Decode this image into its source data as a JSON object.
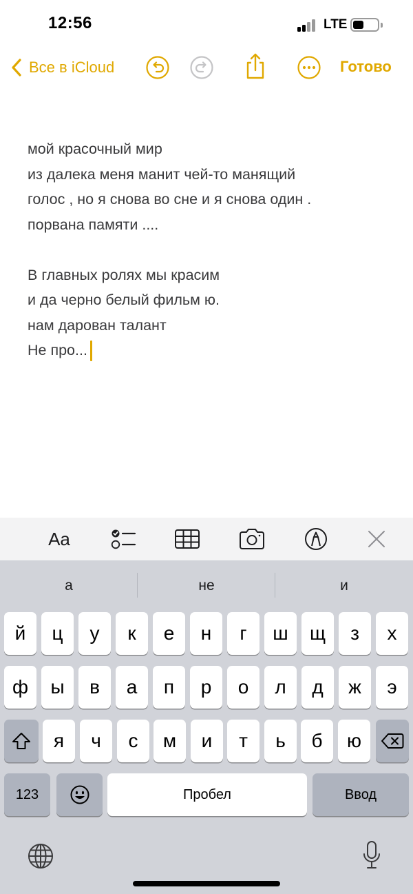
{
  "status_bar": {
    "time": "12:56",
    "network": "LTE"
  },
  "nav": {
    "back_label": "Все в iCloud",
    "done_label": "Готово",
    "icons": [
      "chevron-left-icon",
      "undo-icon",
      "redo-icon",
      "share-icon",
      "more-icon"
    ]
  },
  "note": {
    "lines": [
      "мой красочный мир",
      "из далека меня манит чей-то манящий",
      "голос , но я снова во сне и я снова один .",
      "порвана памяти ....",
      "",
      "В главных ролях мы красим",
      "и да черно белый фильм ю.",
      "нам дарован талант",
      "Не про..."
    ]
  },
  "toolbar": {
    "format_label": "Aa",
    "icons": [
      "format-icon",
      "checklist-icon",
      "table-icon",
      "camera-icon",
      "markup-icon",
      "close-icon"
    ]
  },
  "keyboard": {
    "suggestions": [
      "а",
      "не",
      "и"
    ],
    "row1": [
      "й",
      "ц",
      "у",
      "к",
      "е",
      "н",
      "г",
      "ш",
      "щ",
      "з",
      "х"
    ],
    "row2": [
      "ф",
      "ы",
      "в",
      "а",
      "п",
      "р",
      "о",
      "л",
      "д",
      "ж",
      "э"
    ],
    "row3": [
      "я",
      "ч",
      "с",
      "м",
      "и",
      "т",
      "ь",
      "б",
      "ю"
    ],
    "numbers_label": "123",
    "space_label": "Пробел",
    "return_label": "Ввод",
    "icons": [
      "shift-icon",
      "backspace-icon",
      "emoji-icon",
      "globe-icon",
      "microphone-icon"
    ]
  },
  "colors": {
    "accent": "#e0a800",
    "keyboard_bg": "#d1d3d9",
    "toolbar_bg": "#f3f3f4",
    "text": "#3a3a3c"
  }
}
